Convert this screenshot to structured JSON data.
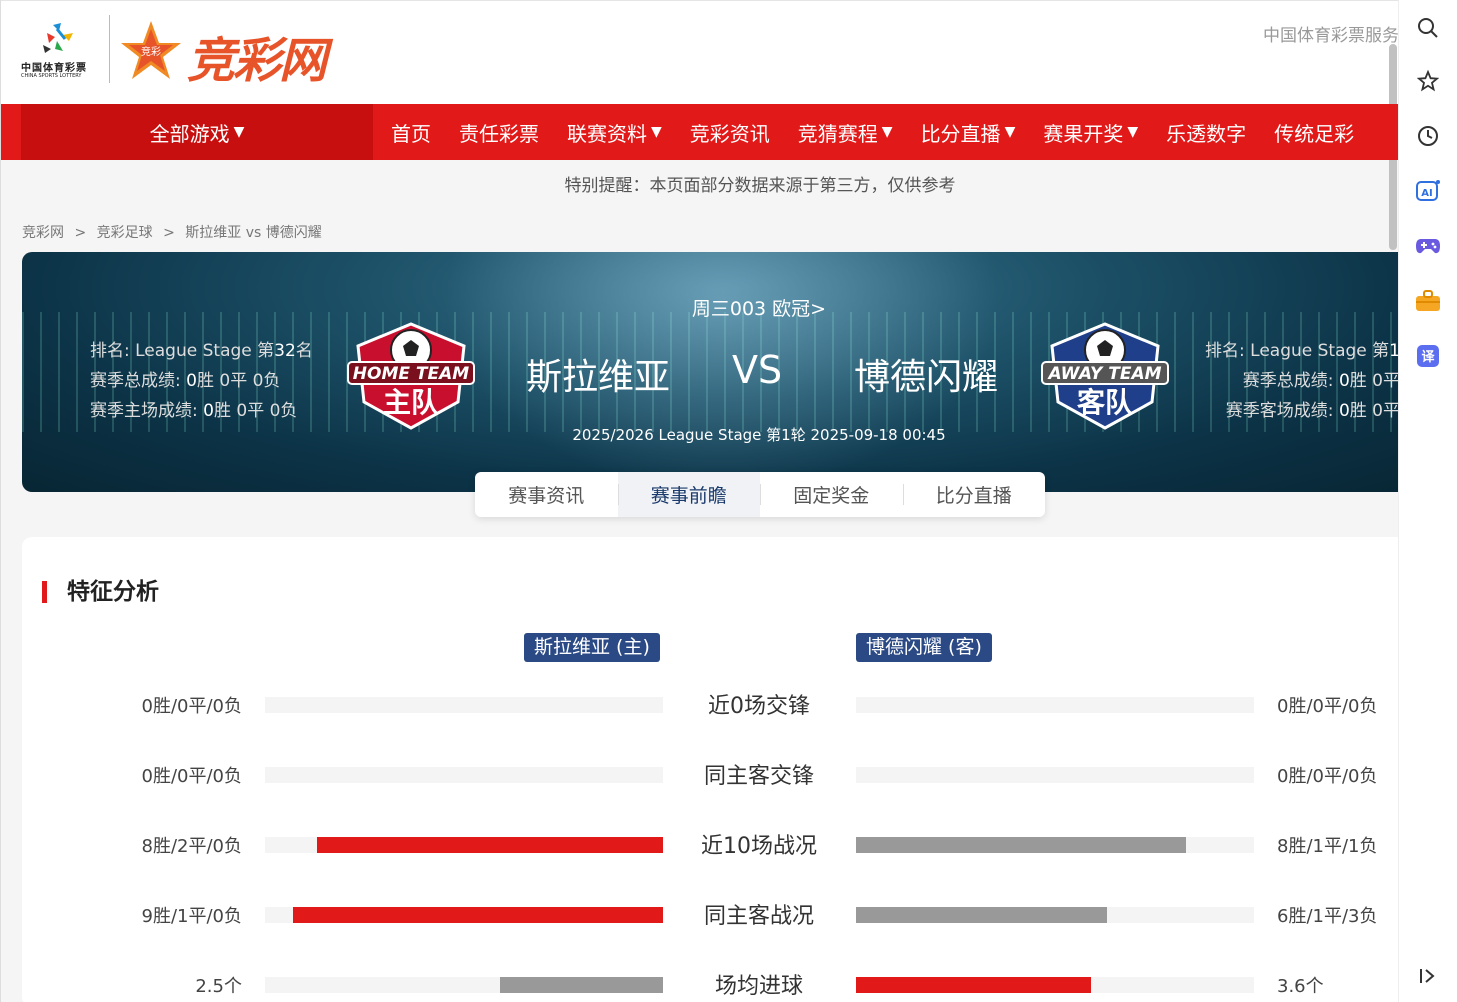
{
  "header": {
    "logo_cslot_cn": "中国体育彩票",
    "logo_cslot_en": "CHINA SPORTS LOTTERY",
    "logo_brand": "竞彩网",
    "logo_star_text": "竞彩",
    "top_link": "中国体育彩票服务"
  },
  "nav": {
    "all_games": "全部游戏",
    "items": [
      {
        "label": "首页",
        "dropdown": false
      },
      {
        "label": "责任彩票",
        "dropdown": false
      },
      {
        "label": "联赛资料",
        "dropdown": true
      },
      {
        "label": "竞彩资讯",
        "dropdown": false
      },
      {
        "label": "竞猜赛程",
        "dropdown": true
      },
      {
        "label": "比分直播",
        "dropdown": true
      },
      {
        "label": "赛果开奖",
        "dropdown": true
      },
      {
        "label": "乐透数字",
        "dropdown": false
      },
      {
        "label": "传统足彩",
        "dropdown": false
      }
    ],
    "caret": "▼"
  },
  "notice": "特别提醒：本页面部分数据来源于第三方，仅供参考",
  "breadcrumb": [
    "竞彩网",
    ">",
    "竞彩足球",
    ">",
    "斯拉维亚 vs 博德闪耀"
  ],
  "match": {
    "top_line": "周三003 欧冠>",
    "home_team": "斯拉维亚",
    "vs": "VS",
    "away_team": "博德闪耀",
    "info_line": "2025/2026 League Stage 第1轮 2025-09-18 00:45",
    "home_badge_top": "HOME TEAM",
    "home_badge_main": "主队",
    "away_badge_top": "AWAY TEAM",
    "away_badge_main": "客队",
    "home_stats": [
      {
        "label": "排名: League Stage 第",
        "value": "32",
        "suffix": "名"
      },
      {
        "label": "赛季总成绩: ",
        "value": "0",
        "suffix": "胜 0平 0负"
      },
      {
        "label": "赛季主场成绩: ",
        "value": "0",
        "suffix": "胜 0平 0负"
      }
    ],
    "away_stats": [
      {
        "label": "排名: League Stage 第",
        "value": "1"
      },
      {
        "label": "赛季总成绩: ",
        "value": "0",
        "suffix": "胜 0平"
      },
      {
        "label": "赛季客场成绩: ",
        "value": "0",
        "suffix": "胜 0平"
      }
    ]
  },
  "tabs": [
    {
      "label": "赛事资讯",
      "active": false
    },
    {
      "label": "赛事前瞻",
      "active": true
    },
    {
      "label": "固定奖金",
      "active": false
    },
    {
      "label": "比分直播",
      "active": false
    }
  ],
  "analysis": {
    "title": "特征分析",
    "home_pill": "斯拉维亚 (主)",
    "away_pill": "博德闪耀 (客)",
    "rows": [
      {
        "label": "近0场交锋",
        "home": "0胜/0平/0负",
        "away": "0胜/0平/0负",
        "home_frac": 0,
        "away_frac": 0,
        "home_color": "#e11919",
        "away_color": "#999999"
      },
      {
        "label": "同主客交锋",
        "home": "0胜/0平/0负",
        "away": "0胜/0平/0负",
        "home_frac": 0,
        "away_frac": 0,
        "home_color": "#e11919",
        "away_color": "#999999"
      },
      {
        "label": "近10场战况",
        "home": "8胜/2平/0负",
        "away": "8胜/1平/1负",
        "home_frac": 0.87,
        "away_frac": 0.83,
        "home_color": "#e11919",
        "away_color": "#999999"
      },
      {
        "label": "同主客战况",
        "home": "9胜/1平/0负",
        "away": "6胜/1平/3负",
        "home_frac": 0.93,
        "away_frac": 0.63,
        "home_color": "#e11919",
        "away_color": "#999999"
      },
      {
        "label": "场均进球",
        "home": "2.5个",
        "away": "3.6个",
        "home_frac": 0.41,
        "away_frac": 0.59,
        "home_color": "#999999",
        "away_color": "#e11919"
      }
    ]
  },
  "colors": {
    "brand_red": "#e11919",
    "nav_dark_red": "#c80f0f",
    "pill_blue": "#2b4a85",
    "bar_gray": "#999999"
  },
  "sidebar_icons": [
    "search-icon",
    "star-icon",
    "history-icon",
    "ai-icon",
    "gamepad-icon",
    "briefcase-icon",
    "translate-icon",
    "collapse-icon"
  ],
  "sidebar": {
    "ai_text": "AI",
    "translate_text": "译"
  }
}
